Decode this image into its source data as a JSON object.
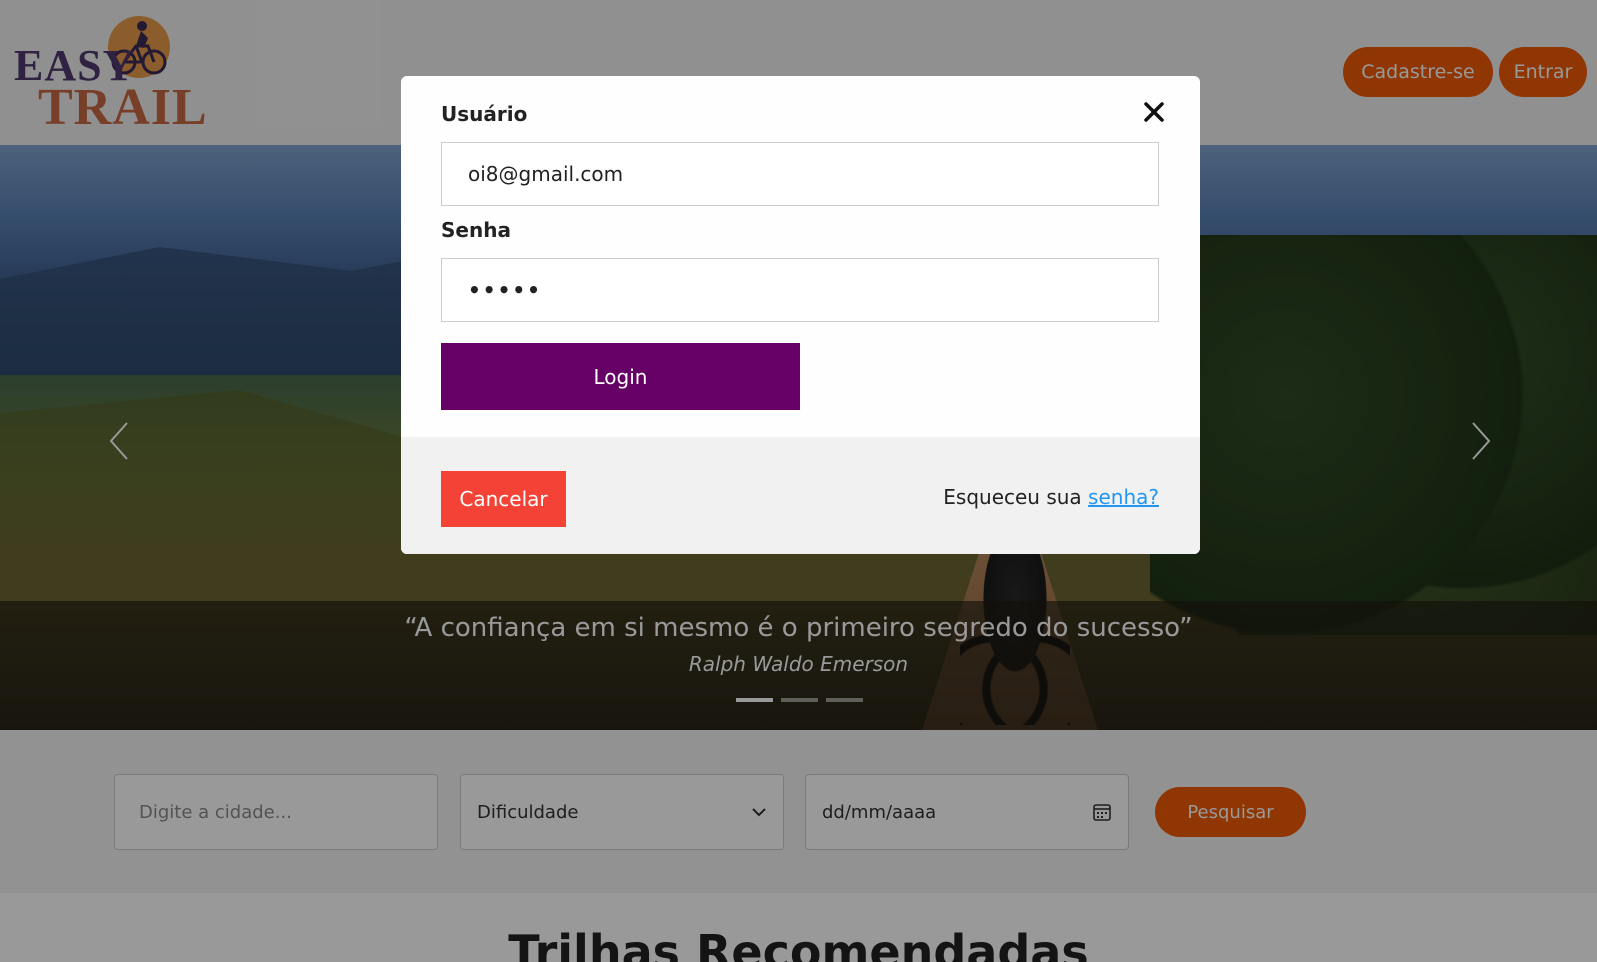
{
  "header": {
    "logo": {
      "line1": "EASY",
      "line2": "TRAIL",
      "icon": "cyclist-icon"
    },
    "signup_label": "Cadastre-se",
    "login_label": "Entrar",
    "accent": "#f05a05"
  },
  "hero": {
    "quote": "“A confiança em si mesmo é o primeiro segredo do sucesso”",
    "author": "Ralph Waldo Emerson",
    "slides_count": 3,
    "active_slide": 1,
    "prev_icon": "chevron-left-icon",
    "next_icon": "chevron-right-icon"
  },
  "search": {
    "city_placeholder": "Digite a cidade...",
    "difficulty_selected": "Dificuldade",
    "date_placeholder": "dd/mm/aaaa",
    "search_label": "Pesquisar"
  },
  "section": {
    "title": "Trilhas Recomendadas"
  },
  "modal": {
    "username_label": "Usuário",
    "username_value": "oi8@gmail.com",
    "password_label": "Senha",
    "password_value": "•••••",
    "login_label": "Login",
    "cancel_label": "Cancelar",
    "forgot_text": "Esqueceu sua",
    "forgot_link": "senha?",
    "login_color": "#660066",
    "cancel_color": "#f44336"
  }
}
